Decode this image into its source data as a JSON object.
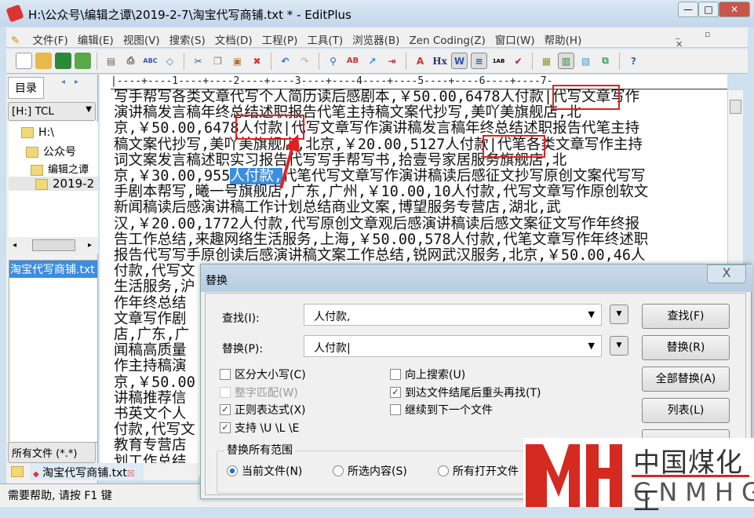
{
  "window": {
    "title": "H:\\公众号\\编辑之谭\\2019-2-7\\淘宝代写商铺.txt * - EditPlus"
  },
  "menu": [
    "文件(F)",
    "编辑(E)",
    "视图(V)",
    "搜索(S)",
    "文档(D)",
    "工程(P)",
    "工具(T)",
    "浏览器(B)",
    "Zen Coding(Z)",
    "窗口(W)",
    "帮助(H)"
  ],
  "toolbar_icons": [
    "new-file-icon",
    "open-icon",
    "save-icon",
    "save-all-icon",
    "print-preview-icon",
    "print-icon",
    "spellcheck-icon",
    "browser-preview-icon",
    "cut-icon",
    "copy-icon",
    "paste-icon",
    "delete-icon",
    "undo-icon",
    "redo-icon",
    "find-icon",
    "replace-icon",
    "goto-icon",
    "indent-icon",
    "font-icon",
    "hex-icon",
    "word-wrap-icon",
    "line-wrap-icon",
    "line-numbers-icon",
    "check-icon",
    "directory-window-icon",
    "cliptext-icon",
    "output-icon",
    "fullscreen-icon",
    "help-icon"
  ],
  "sidebar": {
    "tab": "目录",
    "drive": "[H:] TCL",
    "tree": [
      "H:\\",
      "公众号",
      "编辑之谭",
      "2019-2"
    ],
    "files": [
      "淘宝代写商铺.txt"
    ],
    "filter": "所有文件 (*.*)"
  },
  "editor": {
    "ruler": "|----+----1----+----2----+----3----+----4----+----5----+----6----+----7-",
    "lines": [
      "写手帮写各类文章代写个人简历读后感剧本,￥50.00,6478人付款|代写文章写作",
      "演讲稿发言稿年终总结述职报告代笔主持稿文案代抄写,美吖美旗舰店,北",
      "京,￥50.00,6478人付款|代写文章写作演讲稿发言稿年终总结述职报告代笔主持",
      "稿文案代抄写,美吖美旗舰店,北京,￥20.00,5127人付款|代笔各类文章写作主持",
      "词文案发言稿述职实习报告代写写手帮写书,拾壹号家居服务旗舰店,北",
      "京,￥30.00,955",
      "手剧本帮写,曦一号旗舰店,广东,广州,￥10.00,10人付款,代写文章写作原创软文",
      "新闻稿读后感演讲稿工作计划总结商业文案,博望服务专营店,湖北,武",
      "汉,￥20.00,1772人付款,代写原创文章观后感演讲稿读后感文案征文写作年终报",
      "告工作总结,来趣网络生活服务,上海,￥50.00,578人付款,代笔文章写作年终述职",
      "报告代写写手原创读后感演讲稿文案工作总结,锐网武汉服务,北京,￥50.00,46人",
      "付款,代写文",
      "生活服务,沪",
      "作年终总结",
      "文章写作剧",
      "店,广东,广",
      "闻稿高质量",
      "作主持稿演",
      "京,￥50.00",
      "讲稿推荐信",
      "书英文个人",
      "付款,代写文",
      "教育专营店",
      "划工作总结"
    ],
    "selected": "人付款,",
    "line6_rest": "代笔代写文章写作演讲稿读后感征文抄写原创文案代写写"
  },
  "doc_tab": "淘宝代写商铺.txt",
  "status": "需要帮助, 请按 F1 键",
  "dialog": {
    "title": "替换",
    "find_label": "查找(I):",
    "find_value": "人付款,",
    "replace_label": "替换(P):",
    "replace_value": "人付款|",
    "buttons": [
      "查找(F)",
      "替换(R)",
      "全部替换(A)",
      "列表(L)"
    ],
    "options": [
      {
        "label": "区分大小写(C)",
        "checked": false,
        "disabled": false
      },
      {
        "label": "整字匹配(W)",
        "checked": false,
        "disabled": true
      },
      {
        "label": "正则表达式(X)",
        "checked": true,
        "disabled": false
      },
      {
        "label": "支持 \\U \\L \\E",
        "checked": true,
        "disabled": false
      },
      {
        "label": "向上搜索(U)",
        "checked": false,
        "disabled": false
      },
      {
        "label": "到达文件结尾后重头再找(T)",
        "checked": true,
        "disabled": false
      },
      {
        "label": "继续到下一个文件",
        "checked": false,
        "disabled": false
      }
    ],
    "scope_title": "替换所有范围",
    "scope": [
      "当前文件(N)",
      "所选内容(S)",
      "所有打开文件"
    ],
    "scope_selected": "当前文件(N)"
  },
  "watermark": {
    "letters": "MH",
    "cn": "中国煤化工",
    "en": "CNMHG"
  },
  "colors": {
    "selection": "#3b8de0",
    "annotation": "#e02020",
    "logo": "#d42a20"
  }
}
